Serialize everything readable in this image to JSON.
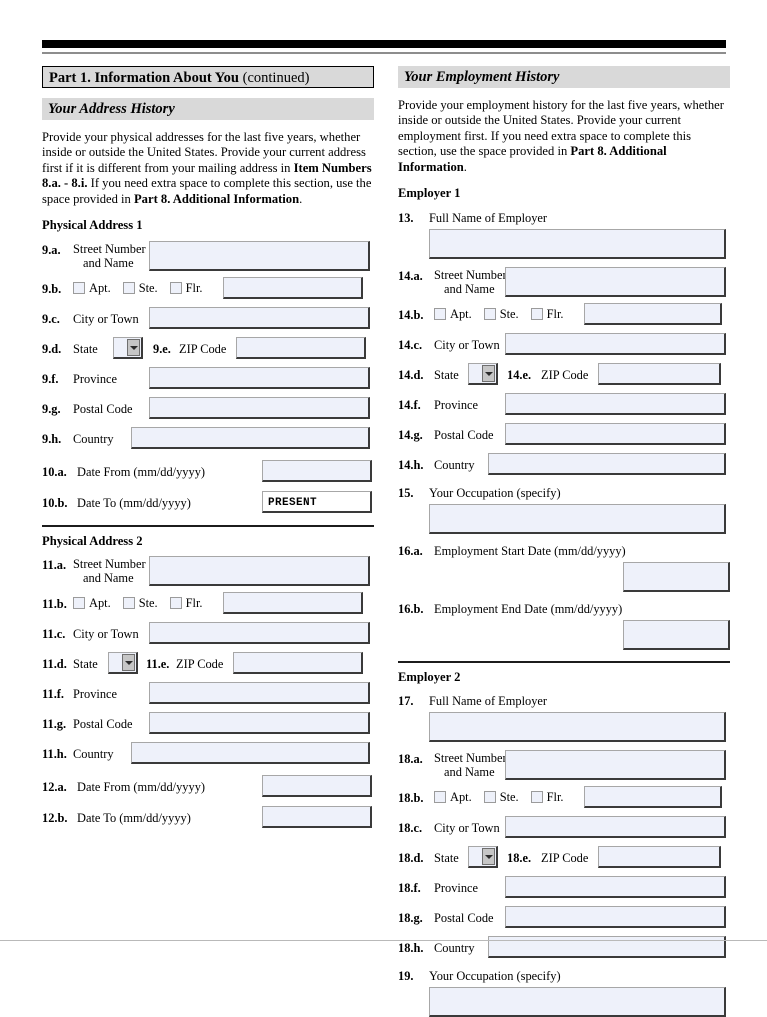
{
  "document": {
    "form_type": "uscis-immigration-form-page"
  },
  "left_column": {
    "part_banner": {
      "bold": "Part 1.  Information About You",
      "regular": "(continued)"
    },
    "section_banner": "Your Address History",
    "intro_paragraph": {
      "segments": [
        {
          "text": "Provide your physical addresses for the last five years, whether inside or outside the United States.  Provide your current address first if it is different from your mailing address in ",
          "bold": false
        },
        {
          "text": "Item Numbers 8.a. - 8.i.",
          "bold": true
        },
        {
          "text": "  If you need extra space to complete this section, use the space provided in ",
          "bold": false
        },
        {
          "text": "Part 8. Additional Information",
          "bold": true
        },
        {
          "text": ".",
          "bold": false
        }
      ]
    },
    "address_1": {
      "heading": "Physical Address 1",
      "fields": {
        "street_num": "9.a.",
        "street_label_line1": "Street Number",
        "street_label_line2": "and Name",
        "street_value": "",
        "unit_num": "9.b.",
        "unit_apt": "Apt.",
        "unit_ste": "Ste.",
        "unit_flr": "Flr.",
        "unit_value": "",
        "city_num": "9.c.",
        "city_label": "City or Town",
        "city_value": "",
        "state_num": "9.d.",
        "state_label": "State",
        "state_value": "",
        "zip_num": "9.e.",
        "zip_label": "ZIP Code",
        "zip_value": "",
        "province_num": "9.f.",
        "province_label": "Province",
        "province_value": "",
        "postal_num": "9.g.",
        "postal_label": "Postal Code",
        "postal_value": "",
        "country_num": "9.h.",
        "country_label": "Country",
        "country_value": "",
        "date_from_num": "10.a.",
        "date_from_label": "Date From (mm/dd/yyyy)",
        "date_from_value": "",
        "date_to_num": "10.b.",
        "date_to_label": "Date To (mm/dd/yyyy)",
        "date_to_value": "PRESENT"
      }
    },
    "address_2": {
      "heading": "Physical Address 2",
      "fields": {
        "street_num": "11.a.",
        "street_label_line1": "Street Number",
        "street_label_line2": "and Name",
        "street_value": "",
        "unit_num": "11.b.",
        "unit_apt": "Apt.",
        "unit_ste": "Ste.",
        "unit_flr": "Flr.",
        "unit_value": "",
        "city_num": "11.c.",
        "city_label": "City or Town",
        "city_value": "",
        "state_num": "11.d.",
        "state_label": "State",
        "state_value": "",
        "zip_num": "11.e.",
        "zip_label": "ZIP Code",
        "zip_value": "",
        "province_num": "11.f.",
        "province_label": "Province",
        "province_value": "",
        "postal_num": "11.g.",
        "postal_label": "Postal Code",
        "postal_value": "",
        "country_num": "11.h.",
        "country_label": "Country",
        "country_value": "",
        "date_from_num": "12.a.",
        "date_from_label": "Date From (mm/dd/yyyy)",
        "date_from_value": "",
        "date_to_num": "12.b.",
        "date_to_label": "Date To (mm/dd/yyyy)",
        "date_to_value": ""
      }
    }
  },
  "right_column": {
    "section_banner": "Your Employment History",
    "intro_paragraph": {
      "segments": [
        {
          "text": "Provide your employment history for the last five years, whether inside or outside the United States.  Provide your current employment first.  If you need extra space to complete this section, use the space provided in ",
          "bold": false
        },
        {
          "text": "Part 8. Additional Information",
          "bold": true
        },
        {
          "text": ".",
          "bold": false
        }
      ]
    },
    "employer_1": {
      "heading": "Employer 1",
      "fields": {
        "name_num": "13.",
        "name_label": "Full Name of Employer",
        "name_value": "",
        "street_num": "14.a.",
        "street_label_line1": "Street Number",
        "street_label_line2": "and Name",
        "street_value": "",
        "unit_num": "14.b.",
        "unit_apt": "Apt.",
        "unit_ste": "Ste.",
        "unit_flr": "Flr.",
        "unit_value": "",
        "city_num": "14.c.",
        "city_label": "City or Town",
        "city_value": "",
        "state_num": "14.d.",
        "state_label": "State",
        "state_value": "",
        "zip_num": "14.e.",
        "zip_label": "ZIP Code",
        "zip_value": "",
        "province_num": "14.f.",
        "province_label": "Province",
        "province_value": "",
        "postal_num": "14.g.",
        "postal_label": "Postal Code",
        "postal_value": "",
        "country_num": "14.h.",
        "country_label": "Country",
        "country_value": "",
        "occupation_num": "15.",
        "occupation_label": "Your Occupation (specify)",
        "occupation_value": "",
        "start_date_num": "16.a.",
        "start_date_label": "Employment Start Date (mm/dd/yyyy)",
        "start_date_value": "",
        "end_date_num": "16.b.",
        "end_date_label": "Employment End Date (mm/dd/yyyy)",
        "end_date_value": ""
      }
    },
    "employer_2": {
      "heading": "Employer 2",
      "fields": {
        "name_num": "17.",
        "name_label": "Full Name of Employer",
        "name_value": "",
        "street_num": "18.a.",
        "street_label_line1": "Street Number",
        "street_label_line2": "and Name",
        "street_value": "",
        "unit_num": "18.b.",
        "unit_apt": "Apt.",
        "unit_ste": "Ste.",
        "unit_flr": "Flr.",
        "unit_value": "",
        "city_num": "18.c.",
        "city_label": "City or Town",
        "city_value": "",
        "state_num": "18.d.",
        "state_label": "State",
        "state_value": "",
        "zip_num": "18.e.",
        "zip_label": "ZIP Code",
        "zip_value": "",
        "province_num": "18.f.",
        "province_label": "Province",
        "province_value": "",
        "postal_num": "18.g.",
        "postal_label": "Postal Code",
        "postal_value": "",
        "country_num": "18.h.",
        "country_label": "Country",
        "country_value": "",
        "occupation_num": "19.",
        "occupation_label": "Your Occupation (specify)",
        "occupation_value": ""
      }
    }
  },
  "colors": {
    "field_fill": "#eef1fa",
    "banner_gray": "#d9d9d9",
    "rule_black": "#000000",
    "border_dark": "#3a3a3a"
  }
}
